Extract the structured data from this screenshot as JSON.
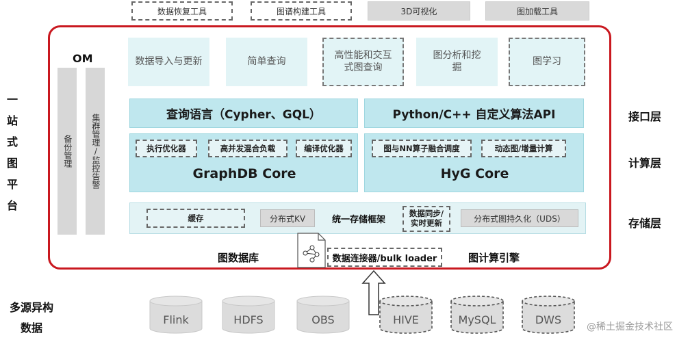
{
  "top_tools": [
    {
      "label": "数据恢复工具",
      "style": "dashed"
    },
    {
      "label": "图谱构建工具",
      "style": "dashed"
    },
    {
      "label": "3D可视化",
      "style": "solid"
    },
    {
      "label": "图加载工具",
      "style": "solid"
    }
  ],
  "platform": {
    "title_chars": [
      "一",
      "站",
      "式",
      "图",
      "平",
      "台"
    ]
  },
  "om": {
    "title": "OM",
    "col1": "备份管理",
    "col2": "集群管理/监控告警"
  },
  "apps": [
    {
      "label": "数据导入与更新",
      "style": "solid"
    },
    {
      "label": "简单查询",
      "style": "solid"
    },
    {
      "label": "高性能和交互式图查询",
      "style": "dashed"
    },
    {
      "label": "图分析和挖掘",
      "style": "solid"
    },
    {
      "label": "图学习",
      "style": "dashed"
    }
  ],
  "interface_layer": {
    "left": "查询语言（Cypher、GQL）",
    "right": "Python/C++ 自定义算法API"
  },
  "compute_layer": {
    "left_opts": [
      "执行优化器",
      "高并发混合负载",
      "编译优化器"
    ],
    "left_core": "GraphDB Core",
    "right_opts": [
      "图与NN算子融合调度",
      "动态图/增量计算"
    ],
    "right_core": "HyG Core"
  },
  "storage_layer": {
    "cache": "缓存",
    "distributed_kv": "分布式KV",
    "unified": "统一存储框架",
    "sync": "数据同步/实时更新",
    "uds": "分布式图持久化（UDS）"
  },
  "layer_labels": {
    "interface": "接口层",
    "compute": "计算层",
    "storage": "存储层"
  },
  "bottom": {
    "graph_db": "图数据库",
    "connector": "数据连接器/bulk loader",
    "graph_engine": "图计算引擎"
  },
  "sources": {
    "title_line1": "多源异构",
    "title_line2": "数据",
    "items": [
      {
        "label": "Flink",
        "style": "solid"
      },
      {
        "label": "HDFS",
        "style": "solid"
      },
      {
        "label": "OBS",
        "style": "solid"
      },
      {
        "label": "HIVE",
        "style": "dashed"
      },
      {
        "label": "MySQL",
        "style": "dashed"
      },
      {
        "label": "DWS",
        "style": "dashed"
      }
    ]
  },
  "watermark": "@稀土掘金技术社区"
}
